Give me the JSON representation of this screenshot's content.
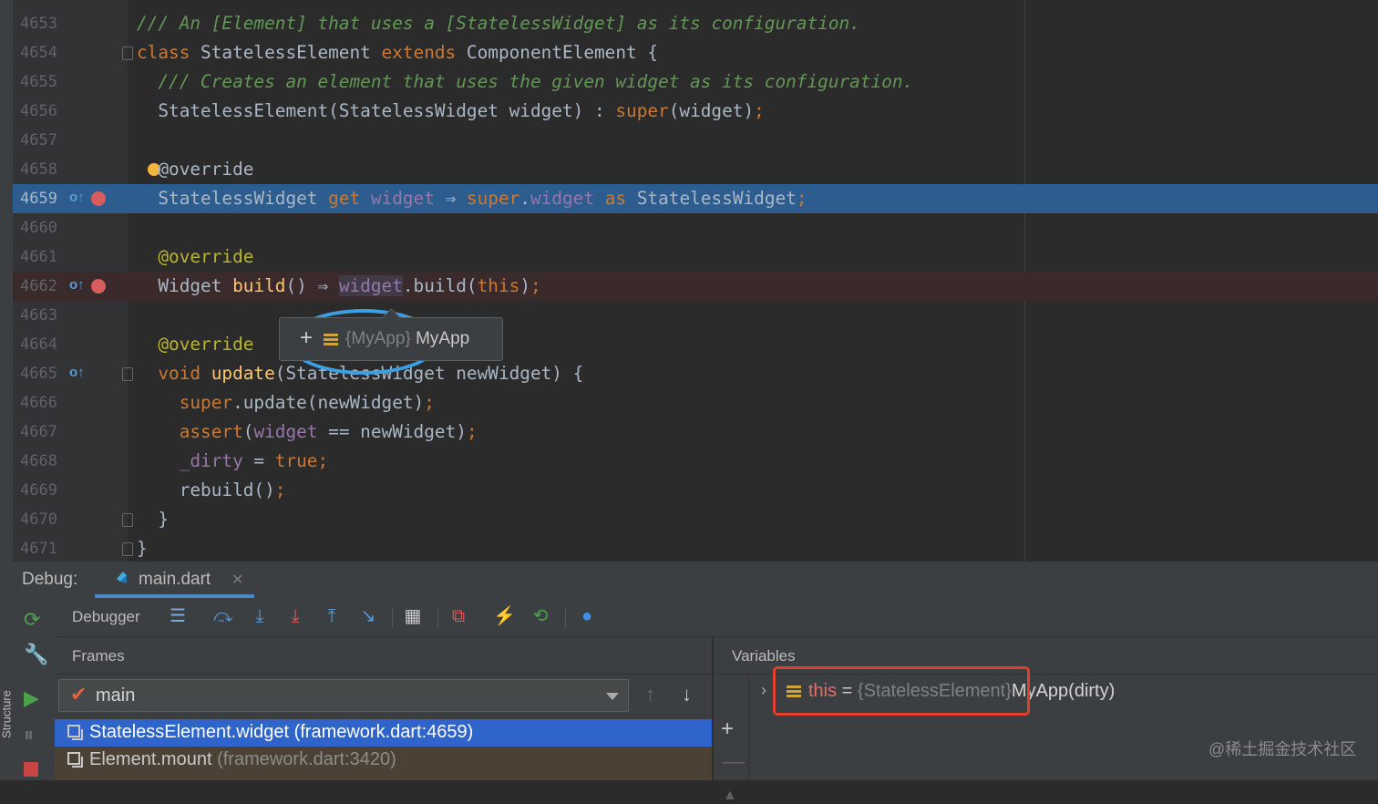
{
  "editor": {
    "lines": [
      {
        "num": "4653",
        "tokens": [
          {
            "t": "/// An [",
            "c": "com"
          },
          {
            "t": "Element",
            "c": "com"
          },
          {
            "t": "] that uses a [",
            "c": "com"
          },
          {
            "t": "StatelessWidget",
            "c": "com"
          },
          {
            "t": "] as its configuration.",
            "c": "com"
          }
        ]
      },
      {
        "num": "4654",
        "tokens": [
          {
            "t": "class ",
            "c": "kw"
          },
          {
            "t": "StatelessElement ",
            "c": ""
          },
          {
            "t": "extends ",
            "c": "kw"
          },
          {
            "t": "ComponentElement {",
            "c": ""
          }
        ]
      },
      {
        "num": "4655",
        "tokens": [
          {
            "t": "  /// Creates an element that uses the given widget as its configuration.",
            "c": "com"
          }
        ]
      },
      {
        "num": "4656",
        "tokens": [
          {
            "t": "  StatelessElement(StatelessWidget widget) : ",
            "c": ""
          },
          {
            "t": "super",
            "c": "kw"
          },
          {
            "t": "(widget)",
            "c": ""
          },
          {
            "t": ";",
            "c": "kw"
          }
        ]
      },
      {
        "num": "4657",
        "tokens": []
      },
      {
        "num": "4658",
        "tokens": [
          {
            "t": "  @override",
            "c": ""
          }
        ]
      },
      {
        "num": "4659",
        "tokens": [
          {
            "t": "  StatelessWidget ",
            "c": ""
          },
          {
            "t": "get ",
            "c": "kw"
          },
          {
            "t": "widget",
            "c": "fld"
          },
          {
            "t": " ⇒ ",
            "c": ""
          },
          {
            "t": "super",
            "c": "kw"
          },
          {
            "t": ".",
            "c": ""
          },
          {
            "t": "widget ",
            "c": "fld"
          },
          {
            "t": "as ",
            "c": "kw"
          },
          {
            "t": "StatelessWidget",
            "c": ""
          },
          {
            "t": ";",
            "c": "kw"
          }
        ]
      },
      {
        "num": "4660",
        "tokens": []
      },
      {
        "num": "4661",
        "tokens": [
          {
            "t": "  @override",
            "c": "ann"
          }
        ]
      },
      {
        "num": "4662",
        "tokens": [
          {
            "t": "  Widget ",
            "c": ""
          },
          {
            "t": "build",
            "c": "fn"
          },
          {
            "t": "() ⇒ ",
            "c": ""
          },
          {
            "t": "widget",
            "c": "fldhl"
          },
          {
            "t": ".build(",
            "c": ""
          },
          {
            "t": "this",
            "c": "kw"
          },
          {
            "t": ")",
            "c": ""
          },
          {
            "t": ";",
            "c": "kw"
          }
        ]
      },
      {
        "num": "4663",
        "tokens": []
      },
      {
        "num": "4664",
        "tokens": [
          {
            "t": "  @override",
            "c": "ann"
          }
        ]
      },
      {
        "num": "4665",
        "tokens": [
          {
            "t": "  void ",
            "c": "kw"
          },
          {
            "t": "update",
            "c": "fn"
          },
          {
            "t": "(StatelessWidget newWidget) {",
            "c": ""
          }
        ]
      },
      {
        "num": "4666",
        "tokens": [
          {
            "t": "    super",
            "c": "kw"
          },
          {
            "t": ".update(newWidget)",
            "c": ""
          },
          {
            "t": ";",
            "c": "kw"
          }
        ]
      },
      {
        "num": "4667",
        "tokens": [
          {
            "t": "    assert",
            "c": "kw"
          },
          {
            "t": "(",
            "c": ""
          },
          {
            "t": "widget",
            "c": "fld"
          },
          {
            "t": " == newWidget)",
            "c": ""
          },
          {
            "t": ";",
            "c": "kw"
          }
        ]
      },
      {
        "num": "4668",
        "tokens": [
          {
            "t": "    _dirty",
            "c": "fld"
          },
          {
            "t": " = ",
            "c": ""
          },
          {
            "t": "true",
            "c": "kw"
          },
          {
            "t": ";",
            "c": "kw"
          }
        ]
      },
      {
        "num": "4669",
        "tokens": [
          {
            "t": "    rebuild()",
            "c": ""
          },
          {
            "t": ";",
            "c": "kw"
          }
        ]
      },
      {
        "num": "4670",
        "tokens": [
          {
            "t": "  }",
            "c": ""
          }
        ]
      },
      {
        "num": "4671",
        "tokens": [
          {
            "t": "}",
            "c": ""
          }
        ]
      }
    ]
  },
  "tooltip": {
    "type": "{MyApp} ",
    "value": "MyApp"
  },
  "debug": {
    "label": "Debug:",
    "tab": "main.dart",
    "debugger_tab": "Debugger",
    "frames_title": "Frames",
    "variables_title": "Variables",
    "thread": "main",
    "frames": [
      {
        "method": "StatelessElement.widget",
        "location": " (framework.dart:4659)"
      },
      {
        "method": "Element.mount",
        "location": " (framework.dart:3420)"
      }
    ],
    "variable": {
      "name": "this",
      "eq": " = ",
      "type": "{StatelessElement}",
      "value": "MyApp(dirty)"
    }
  },
  "sidebar": {
    "structure": "Structure"
  },
  "watermark": "@稀土掘金技术社区",
  "colors": {
    "exec_line": "#2d5c8f",
    "breakpoint": "#db5c5c",
    "selected_frame": "#2f65ca",
    "annotation_blue": "#3aa0e6",
    "annotation_red": "#e0402d"
  }
}
